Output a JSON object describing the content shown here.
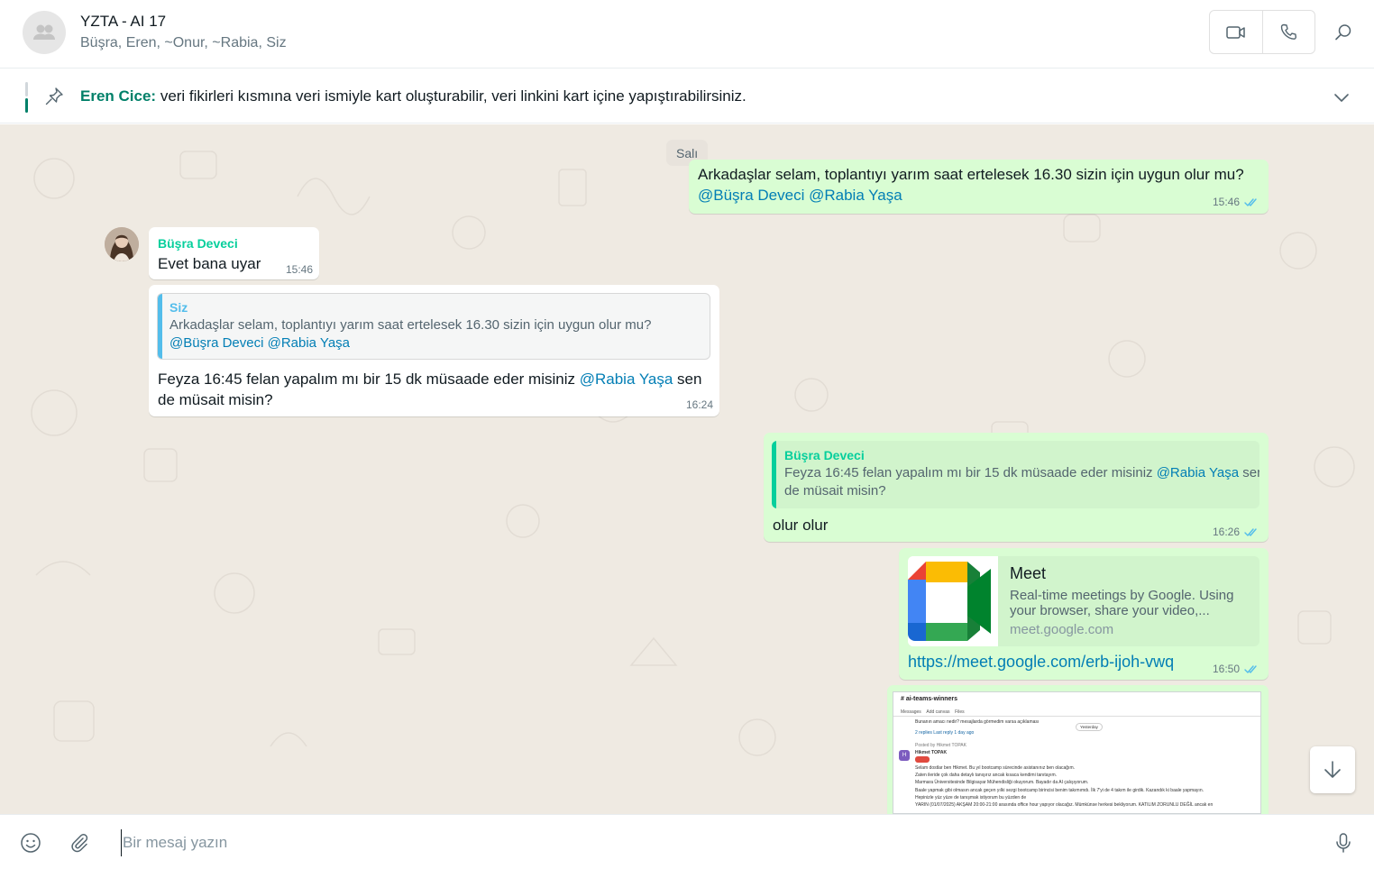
{
  "header": {
    "title": "YZTA - AI 17",
    "members": "Büşra, Eren, ~Onur, ~Rabia, Siz"
  },
  "pinned": {
    "author": "Eren Cice:",
    "text": " veri fikirleri kısmına veri ismiyle kart oluşturabilir, veri linkini kart içine yapıştırabilirsiniz."
  },
  "chat": {
    "date_divider": "Salı",
    "messages": [
      {
        "line1": "Arkadaşlar selam, toplantıyı yarım saat ertelesek 16.30 sizin için uygun olur mu?",
        "mention1": "@Büşra Deveci",
        "mention2": "@Rabia Yaşa",
        "time": "15:46"
      },
      {
        "sender": "Büşra Deveci",
        "text": "Evet bana uyar",
        "time": "15:46"
      },
      {
        "quote_author": "Siz",
        "quote_line1": "Arkadaşlar selam, toplantıyı yarım saat ertelesek 16.30 sizin için uygun olur mu?",
        "quote_mention1": "@Büşra Deveci",
        "quote_mention2": "@Rabia Yaşa",
        "text_before": "Feyza 16:45 felan yapalım mı bir 15 dk müsaade eder misiniz ",
        "mention": "@Rabia Yaşa",
        "text_after1": " sen",
        "text_after2": "de müsait misin?",
        "time": "16:24"
      },
      {
        "quote_author": "Büşra Deveci",
        "quote_before": "Feyza 16:45 felan yapalım mı bir 15 dk müsaade eder misiniz ",
        "quote_mention": "@Rabia Yaşa",
        "quote_after1": " sen",
        "quote_after2": "de müsait misin?",
        "text": "olur olur",
        "time": "16:26"
      },
      {
        "link_title": "Meet",
        "link_desc": "Real-time meetings by Google. Using your browser, share your video,...",
        "link_domain": "meet.google.com",
        "url": "https://meet.google.com/erb-ijoh-vwq",
        "time": "16:50"
      }
    ],
    "screenshot": {
      "channel": "ai-teams-winners",
      "tabs": [
        "Messages",
        "Add canvas",
        "Files"
      ],
      "lines": [
        "Bunanın amacı nedir? mesajlarda görmedim varsa açıklaması",
        "2 replies   Last reply 1 day ago",
        "Posted by Hikmet TOPAK",
        "Hikmet TOPAK",
        "Selam dostlar ben Hikmet. Bu yıl bootcamp sürecinde asistanınız ben olacağım.",
        "Zaten ileride çok daha detaylı tanışırız ancak kısaca kendimi tanıtayım.",
        "Marmara Üniversitesinde Bilgisayar Mühendisliği okuyorum. Bayadır da AI çalışıyorum.",
        "Baale yapmak gibi olmasın ancak geçen yılki sezgi bootcamp birincisi benim takımımdı. İlk 7'yi de 4 takım ile girdik. Kazandık ki baale yapmayın.",
        "Hepinizle yüz yüze de tanışmak istiyorum bu yüzden de",
        "YARIN (01/07/2025) AKŞAM 20:00-21:00 arasında office hour yapıyor olacağız. Mümkünse herkesi bekliyorum. KATILIM ZORUNLU DEĞİL ancak en"
      ],
      "yesterday": "Yesterday"
    }
  },
  "composer": {
    "placeholder": "Bir mesaj yazın"
  },
  "colors": {
    "outgoing_bubble": "#d9fdd3",
    "incoming_bubble": "#ffffff",
    "accent": "#008069",
    "mention": "#027eb5",
    "ticks": "#53bdeb"
  }
}
